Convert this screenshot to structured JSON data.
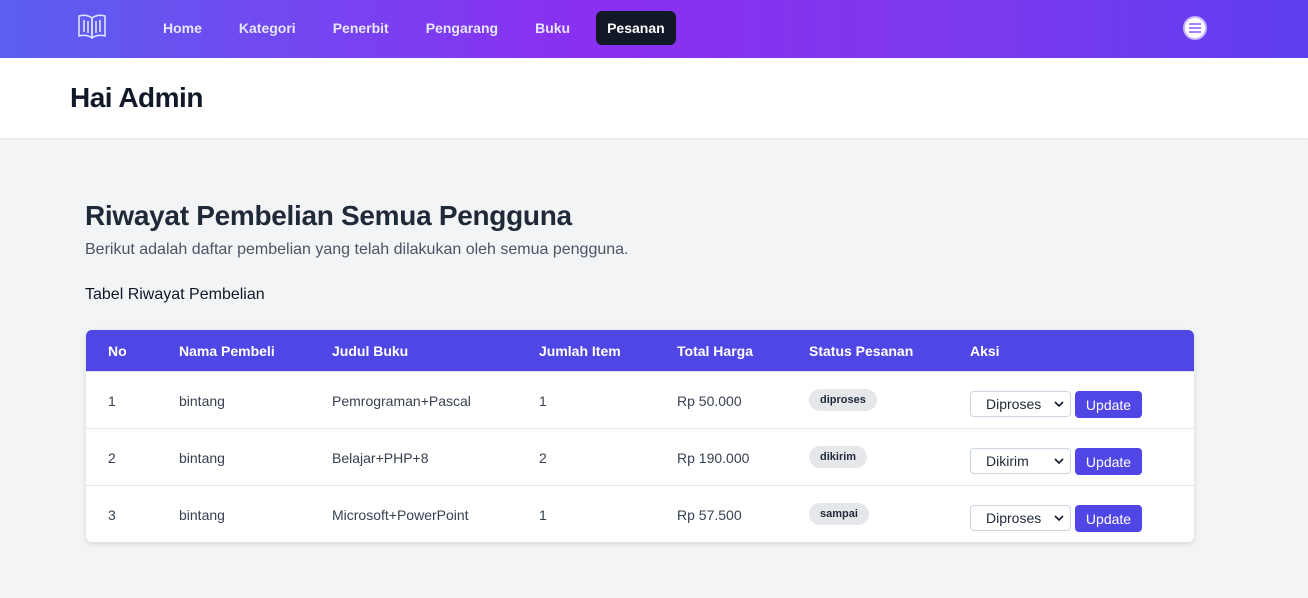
{
  "nav": {
    "links": [
      "Home",
      "Kategori",
      "Penerbit",
      "Pengarang",
      "Buku",
      "Pesanan"
    ],
    "active": "Pesanan"
  },
  "header": {
    "title": "Hai Admin"
  },
  "main": {
    "title": "Riwayat Pembelian Semua Pengguna",
    "description": "Berikut adalah daftar pembelian yang telah dilakukan oleh semua pengguna.",
    "caption": "Tabel Riwayat Pembelian"
  },
  "table": {
    "columns": [
      "No",
      "Nama Pembeli",
      "Judul Buku",
      "Jumlah Item",
      "Total Harga",
      "Status Pesanan",
      "Aksi"
    ],
    "rows": [
      {
        "no": "1",
        "name": "bintang",
        "book": "Pemrograman+Pascal",
        "qty": "1",
        "total": "Rp 50.000",
        "status": "diproses",
        "select": "Diproses",
        "button": "Update"
      },
      {
        "no": "2",
        "name": "bintang",
        "book": "Belajar+PHP+8",
        "qty": "2",
        "total": "Rp 190.000",
        "status": "dikirim",
        "select": "Dikirim",
        "button": "Update"
      },
      {
        "no": "3",
        "name": "bintang",
        "book": "Microsoft+PowerPoint",
        "qty": "1",
        "total": "Rp 57.500",
        "status": "sampai",
        "select": "Diproses",
        "button": "Update"
      }
    ]
  },
  "colors": {
    "nav_gradient_start": "#5b5ff0",
    "nav_gradient_mid": "#8b2ff0",
    "table_header": "#4f46e5",
    "button": "#4f46e5",
    "active_nav": "#111827",
    "badge": "#e5e7eb"
  },
  "icons": {
    "logo": "book-icon",
    "user": "user-menu-icon",
    "select": "chevron-down-icon"
  }
}
